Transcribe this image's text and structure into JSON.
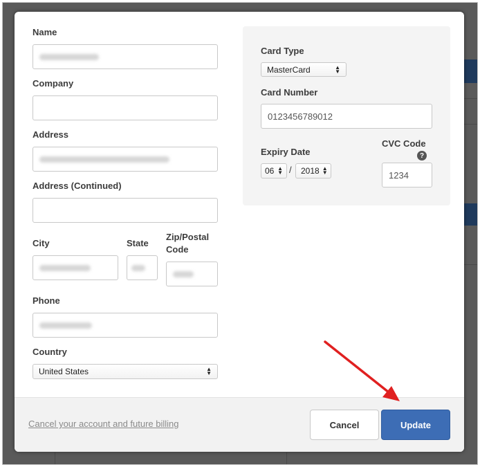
{
  "form": {
    "name_label": "Name",
    "company_label": "Company",
    "address_label": "Address",
    "address2_label": "Address (Continued)",
    "city_label": "City",
    "state_label": "State",
    "zip_label_line1": "Zip/Postal",
    "zip_label_line2": "Code",
    "phone_label": "Phone",
    "country_label": "Country",
    "country_value": "United States"
  },
  "card": {
    "type_label": "Card Type",
    "type_value": "MasterCard",
    "number_label": "Card Number",
    "number_value": "0123456789012",
    "expiry_label": "Expiry Date",
    "expiry_month": "06",
    "expiry_separator": "/",
    "expiry_year": "2018",
    "cvc_label": "CVC Code",
    "cvc_help": "?",
    "cvc_value": "1234"
  },
  "footer": {
    "cancel_account_link": "Cancel your account and future billing",
    "cancel_button": "Cancel",
    "update_button": "Update"
  },
  "colors": {
    "primary_button": "#3d6db5",
    "annotation_arrow": "#e02020",
    "backdrop": "#5a5a5a"
  }
}
